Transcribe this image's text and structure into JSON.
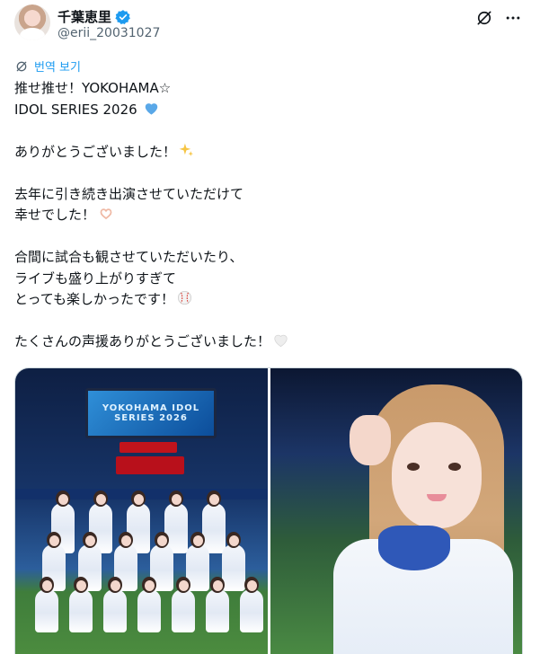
{
  "author": {
    "display_name": "千葉恵里",
    "handle": "@erii_20031027",
    "verified": true,
    "avatar_icon": "avatar-image"
  },
  "header_icons": [
    "grok-icon",
    "more-icon"
  ],
  "translate": {
    "label": "번역 보기",
    "icon": "translate-icon"
  },
  "tweet": {
    "lines": [
      "推せ推せ！YOKOHAMA☆",
      "IDOL SERIES 2026",
      "",
      "ありがとうございました！",
      "",
      "去年に引き続き出演させていただけて",
      "幸せでした！",
      "",
      "合間に試合も観させていただいたり、",
      "ライブも盛り上がりすぎて",
      "とっても楽しかったです！",
      "",
      "たくさんの声援ありがとうございました！"
    ],
    "emojis": {
      "line2": "blue-heart-emoji",
      "line4": "sparkles-emoji",
      "line7": "heart-hands-emoji",
      "line11": "baseball-emoji",
      "line13": "white-heart-emoji"
    }
  },
  "media": {
    "left_photo": {
      "screen_text": "YOKOHAMA IDOL SERIES 2026"
    },
    "right_photo": {}
  },
  "colors": {
    "accent": "#1d9bf0",
    "text": "#0f1419",
    "secondary_text": "#536471",
    "blue_heart": "#5aa8e8",
    "sparkle": "#f6c544",
    "heart_hands": "#f7d0c0",
    "baseball_stitch": "#d9342b",
    "white_heart": "#e8e8e8"
  }
}
